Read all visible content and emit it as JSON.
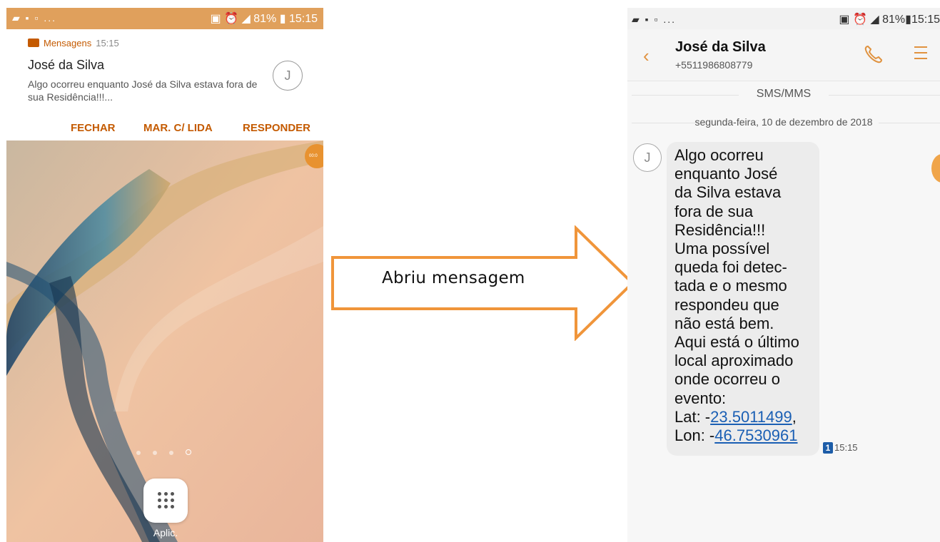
{
  "left_phone": {
    "status_bar": {
      "battery": "81%",
      "time": "15:15"
    },
    "notification": {
      "app_name": "Mensagens",
      "time": "15:15",
      "sender": "José da Silva",
      "preview": "Algo ocorreu enquanto José da Silva estava fora de sua Residência!!!...",
      "avatar_letter": "J",
      "actions": {
        "close": "FECHAR",
        "mark_read": "MAR. C/ LIDA",
        "reply": "RESPONDER"
      }
    },
    "apps_label": "Aplic.",
    "record_badge": "00:0"
  },
  "arrow": {
    "label": "Abriu mensagem",
    "color": "#f0953a"
  },
  "right_phone": {
    "status_bar": {
      "battery": "81%",
      "time": "15:15"
    },
    "header": {
      "name": "José da Silva",
      "number": "+5511986808779"
    },
    "channel_label": "SMS/MMS",
    "date_label": "segunda-feira, 10 de dezembro de 2018",
    "message": {
      "avatar_letter": "J",
      "body": "Algo ocorreu\nenquanto José\nda Silva estava\nfora de sua\nResidência!!!\nUma possível\nqueda foi detec-\ntada e o mesmo\nrespondeu que\nnão está bem.\nAqui está o último\nlocal aproximado\nonde ocorreu o\nevento:",
      "lat_prefix": "Lat: -",
      "lat_value": "23.5011499",
      "lat_suffix": ",",
      "lon_prefix": "Lon: -",
      "lon_value": "46.7530961",
      "sim_badge": "1",
      "time": "15:15"
    }
  },
  "colors": {
    "accent_orange": "#e0923f",
    "notif_orange": "#c45a00",
    "link_blue": "#1a5fb4"
  }
}
